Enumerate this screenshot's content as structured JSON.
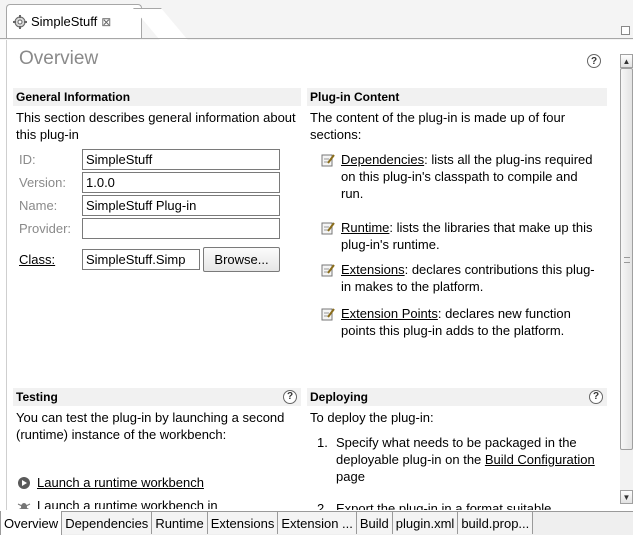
{
  "editor_tab": {
    "title": "SimpleStuff",
    "close": "⊠"
  },
  "overview": {
    "title": "Overview",
    "help": "?"
  },
  "general": {
    "header": "General Information",
    "description": "This section describes general information about this plug-in",
    "fields": [
      {
        "label": "ID:",
        "value": "SimpleStuff"
      },
      {
        "label": "Version:",
        "value": "1.0.0"
      },
      {
        "label": "Name:",
        "value": "SimpleStuff Plug-in"
      },
      {
        "label": "Provider:",
        "value": ""
      }
    ],
    "class_label": "Class:",
    "class_value": "SimpleStuff.Simp",
    "browse": "Browse..."
  },
  "content": {
    "header": "Plug-in Content",
    "description": "The content of the plug-in is made up of four sections:",
    "items": [
      {
        "link": "Dependencies",
        "text": ": lists all the plug-ins required on this plug-in's classpath to compile and run."
      },
      {
        "link": "Runtime",
        "text": ": lists the libraries that make up this plug-in's runtime."
      },
      {
        "link": "Extensions",
        "text": ": declares contributions this plug-in makes to the platform."
      },
      {
        "link": "Extension Points",
        "text": ": declares new function points this plug-in adds to the platform."
      }
    ]
  },
  "testing": {
    "header": "Testing",
    "description": "You can test the plug-in by launching a second (runtime) instance of the workbench:",
    "launch_run": "Launch a runtime workbench",
    "launch_debug": "Launch a runtime workbench in"
  },
  "deploying": {
    "header": "Deploying",
    "description": "To deploy the plug-in:",
    "step1_num": "1.",
    "step1_pre": "Specify what needs to be packaged in the deployable plug-in on the ",
    "step1_link": "Build Configuration",
    "step1_post": " page",
    "step2_num": "2.",
    "step2_text": "Export the plug-in in a format suitable"
  },
  "bottom_tabs": [
    "Overview",
    "Dependencies",
    "Runtime",
    "Extensions",
    "Extension ...",
    "Build",
    "plugin.xml",
    "build.prop..."
  ],
  "colors": {
    "header_bg": "#f1f1f1",
    "title_gray": "#8a8a8a",
    "border": "#7a7a7a"
  }
}
